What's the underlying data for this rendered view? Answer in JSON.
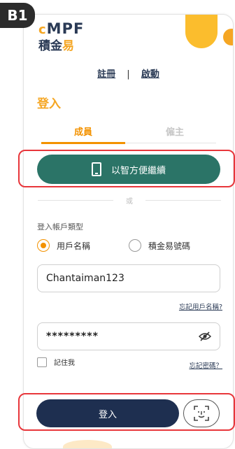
{
  "badge": "B1",
  "logo": {
    "line1_mark": "c",
    "line1_text": "MPF",
    "line2_a": "積金",
    "line2_b": "易"
  },
  "top_links": {
    "register": "註冊",
    "separator": "|",
    "activate": "啟動"
  },
  "page_title": "登入",
  "tabs": [
    {
      "label": "成員",
      "active": true
    },
    {
      "label": "僱主",
      "active": false
    }
  ],
  "smart_button": {
    "label": "以智方便繼續",
    "icon": "phone-icon"
  },
  "or_text": "或",
  "login_type_label": "登入帳戶類型",
  "radio_options": [
    {
      "label": "用戶名稱",
      "selected": true
    },
    {
      "label": "積金易號碼",
      "selected": false
    }
  ],
  "username_value": "Chantaiman123",
  "forgot_username": "忘記用戶名稱?",
  "password_value": "*********",
  "remember_me": "記住我",
  "forgot_password": "忘記密碼？",
  "login_button": "登入",
  "colors": {
    "accent": "#f39200",
    "green_button": "#2b7467",
    "navy_button": "#1e2f50",
    "highlight": "#e8363b"
  }
}
